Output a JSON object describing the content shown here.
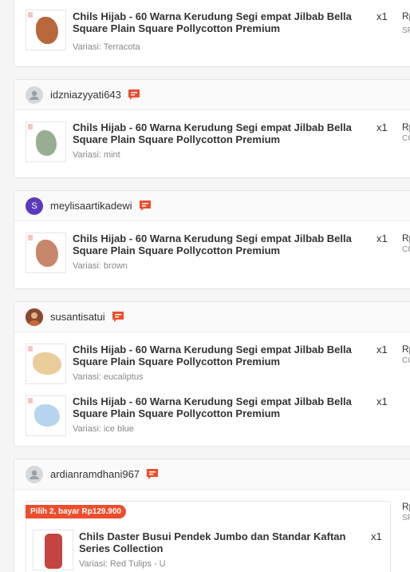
{
  "orders": [
    {
      "username": "",
      "items": [
        {
          "title": "Chils Hijab - 60 Warna Kerudung Segi empat Jilbab Bella Square Plain Square Pollycotton Premium",
          "qty": "x1",
          "variant": "Variasi: Terracota",
          "price": "Rp",
          "sku": "SF"
        }
      ]
    },
    {
      "username": "idzniazyyati643",
      "items": [
        {
          "title": "Chils Hijab - 60 Warna Kerudung Segi empat Jilbab Bella Square Plain Square Pollycotton Premium",
          "qty": "x1",
          "variant": "Variasi: mint",
          "price": "Rp",
          "sku": "CC"
        }
      ]
    },
    {
      "username": "meylisaartikadewi",
      "avatar_letter": "S",
      "items": [
        {
          "title": "Chils Hijab - 60 Warna Kerudung Segi empat Jilbab Bella Square Plain Square Pollycotton Premium",
          "qty": "x1",
          "variant": "Variasi: brown",
          "price": "Rp",
          "sku": "CC"
        }
      ]
    },
    {
      "username": "susantisatui",
      "items": [
        {
          "title": "Chils Hijab - 60 Warna Kerudung Segi empat Jilbab Bella Square Plain Square Pollycotton Premium",
          "qty": "x1",
          "variant": "Variasi: eucaliptus",
          "price": "Rp",
          "sku": "CC"
        },
        {
          "title": "Chils Hijab - 60 Warna Kerudung Segi empat Jilbab Bella Square Plain Square Pollycotton Premium",
          "qty": "x1",
          "variant": "Variasi: ice blue",
          "price": "",
          "sku": ""
        }
      ]
    },
    {
      "username": "ardianramdhani967",
      "promo": "Pilih 2, bayar Rp129.900",
      "items": [
        {
          "title": "Chils Daster Busui Pendek Jumbo dan Standar Kaftan Series Collection",
          "qty": "x1",
          "variant": "Variasi: Red Tulips - U",
          "price": "Rp",
          "sku": "SF"
        }
      ]
    }
  ],
  "colors": {
    "accent": "#ee4d2d",
    "chat_icon": "#ee4d2d"
  },
  "icons": {
    "chat": "chat-icon",
    "avatar": "user-avatar-icon"
  }
}
